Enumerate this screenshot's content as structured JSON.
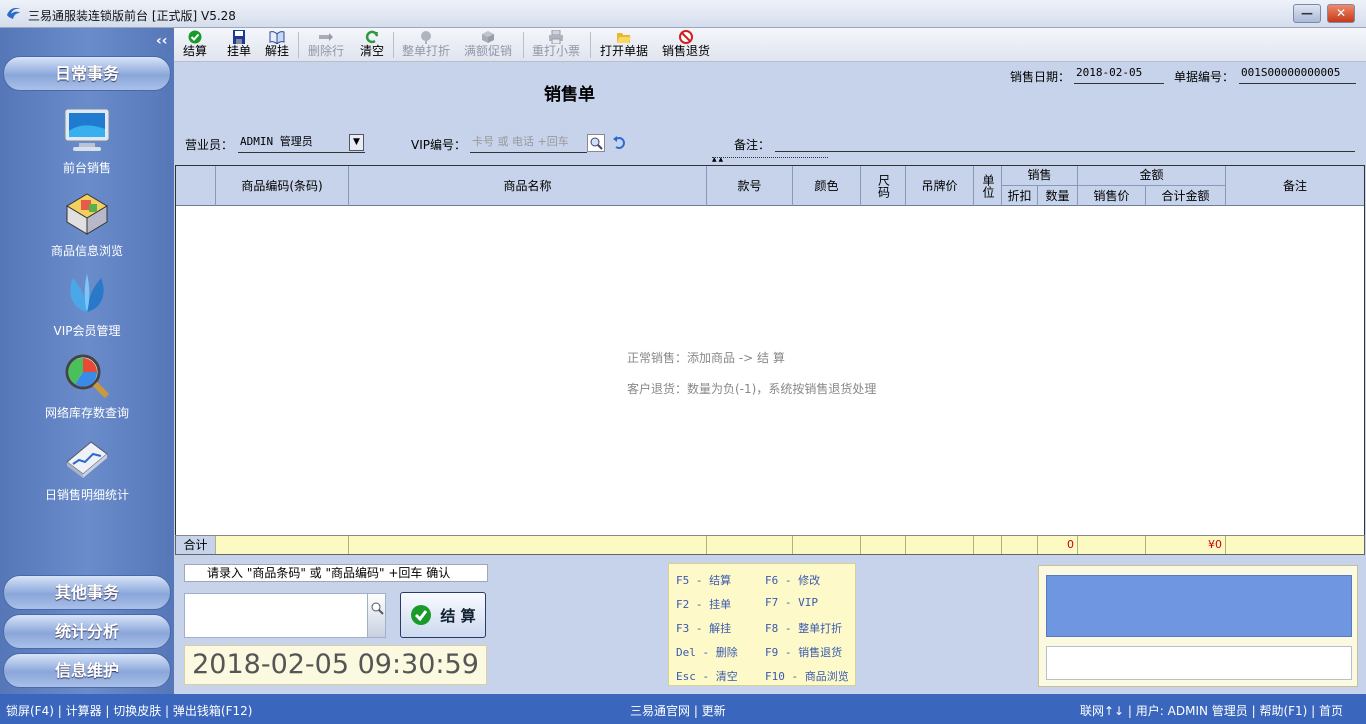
{
  "window": {
    "title": "三易通服装连锁版前台 [正式版] V5.28",
    "minimize": "—",
    "close": "✕"
  },
  "sidebar": {
    "collapse": "‹‹",
    "top_category": "日常事务",
    "items": [
      {
        "label": "前台销售",
        "icon": "monitor-icon"
      },
      {
        "label": "商品信息浏览",
        "icon": "cube-box-icon"
      },
      {
        "label": "VIP会员管理",
        "icon": "vip-leaf-icon"
      },
      {
        "label": "网络库存数查询",
        "icon": "magnifier-chart-icon"
      },
      {
        "label": "日销售明细统计",
        "icon": "chart-book-icon"
      }
    ],
    "bottom_categories": [
      "其他事务",
      "统计分析",
      "信息维护"
    ]
  },
  "toolbar": {
    "buttons": [
      {
        "label": "结算",
        "enabled": true
      },
      {
        "label": "挂单",
        "enabled": true
      },
      {
        "label": "解挂",
        "enabled": true
      },
      {
        "label": "删除行",
        "enabled": false
      },
      {
        "label": "清空",
        "enabled": true
      },
      {
        "label": "整单打折",
        "enabled": false
      },
      {
        "label": "满额促销",
        "enabled": false
      },
      {
        "label": "重打小票",
        "enabled": false
      },
      {
        "label": "打开单据",
        "enabled": true
      },
      {
        "label": "销售退货",
        "enabled": true
      }
    ]
  },
  "form": {
    "title": "销售单",
    "date_label": "销售日期：",
    "date_value": "2018-02-05",
    "docno_label": "单据编号：",
    "docno_value": "001S00000000005",
    "salesman_label": "营业员：",
    "salesman_value": "ADMIN 管理员",
    "vip_label": "VIP编号：",
    "vip_placeholder": "卡号 或 电话 +回车",
    "note_label": "备注："
  },
  "grid": {
    "headers": {
      "code": "商品编码(条码)",
      "name": "商品名称",
      "style": "款号",
      "color": "颜色",
      "size": "尺码",
      "tag_price": "吊牌价",
      "unit": "单位",
      "sales_group": "销售",
      "discount": "折扣",
      "qty": "数量",
      "amount_group": "金额",
      "sale_price": "销售价",
      "total": "合计金额",
      "remark": "备注"
    },
    "hint1": "正常销售：添加商品 -> 结 算",
    "hint2": "客户退货：数量为负(-1)，系统按销售退货处理",
    "sum_label": "合计",
    "sum_qty": "0",
    "sum_total": "¥0"
  },
  "bottom": {
    "prompt": "请录入 \"商品条码\" 或 \"商品编码\" +回车 确认",
    "checkout_label": "结 算",
    "clock": "2018-02-05 09:30:59",
    "shortcuts": [
      [
        "F5 - 结算",
        "F6 - 修改"
      ],
      [
        "F2 - 挂单",
        "F7 - VIP"
      ],
      [
        "F3 - 解挂",
        "F8 - 整单打折"
      ],
      [
        "Del - 删除",
        "F9 - 销售退货"
      ],
      [
        "Esc - 清空",
        "F10 - 商品浏览"
      ]
    ]
  },
  "statusbar": {
    "left": "锁屏(F4) | 计算器 | 切换皮肤 | 弹出钱箱(F12)",
    "center": "三易通官网 | 更新",
    "right": "联网↑↓ | 用户: ADMIN 管理员 | 帮助(F1) | 首页"
  },
  "colors": {
    "sidebar": "#5a7cbc",
    "statusbar": "#3a67bd",
    "grid_header": "#c6d3ea",
    "sum_row": "#fdf9c2"
  }
}
